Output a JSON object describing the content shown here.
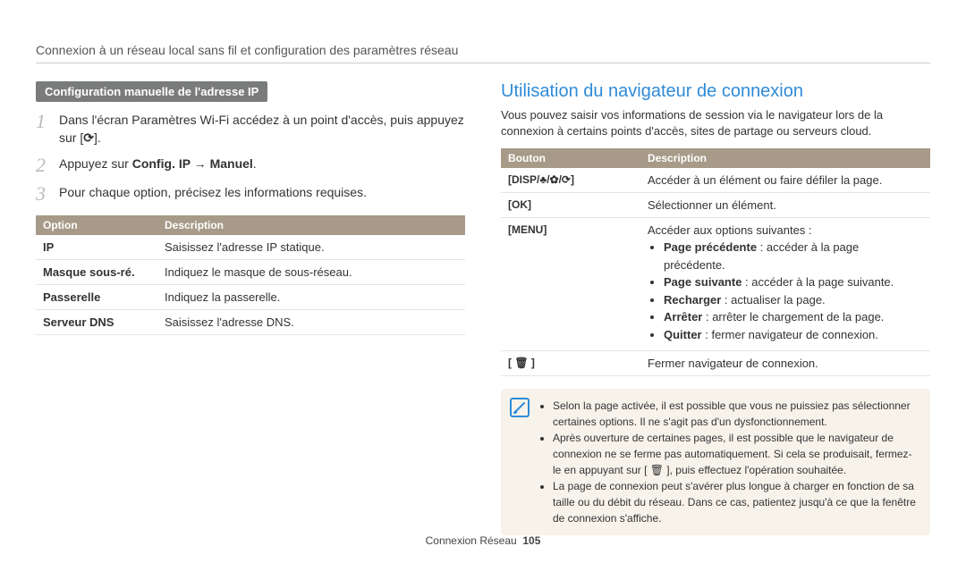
{
  "breadcrumb": "Connexion à un réseau local sans fil et configuration des paramètres réseau",
  "left": {
    "pill": "Configuration manuelle de l'adresse IP",
    "steps": [
      {
        "n": "1",
        "text_pre": "Dans l'écran Paramètres Wi-Fi accédez à un point d'accès, puis appuyez sur [",
        "text_post": "]."
      },
      {
        "n": "2",
        "text_pre": "Appuyez sur ",
        "bold": "Config. IP → Manuel",
        "text_post": "."
      },
      {
        "n": "3",
        "text_pre": "Pour chaque option, précisez les informations requises."
      }
    ],
    "table": {
      "headers": [
        "Option",
        "Description"
      ],
      "rows": [
        [
          "IP",
          "Saisissez l'adresse IP statique."
        ],
        [
          "Masque sous-ré.",
          "Indiquez le masque de sous-réseau."
        ],
        [
          "Passerelle",
          "Indiquez la passerelle."
        ],
        [
          "Serveur DNS",
          "Saisissez l'adresse DNS."
        ]
      ]
    }
  },
  "right": {
    "title": "Utilisation du navigateur de connexion",
    "intro": "Vous pouvez saisir vos informations de session via le navigateur lors de la connexion à certains points d'accès, sites de partage ou serveurs cloud.",
    "table": {
      "headers": [
        "Bouton",
        "Description"
      ],
      "rows": [
        {
          "btn_glyph": "[DISP/♣/✿/⟳]",
          "desc_text": "Accéder à un élément ou faire défiler la page."
        },
        {
          "btn_glyph": "[OK]",
          "desc_text": "Sélectionner un élément."
        },
        {
          "btn_glyph": "[MENU]",
          "desc_list_intro": "Accéder aux options suivantes :",
          "desc_list": [
            {
              "b": "Page précédente",
              "rest": " : accéder à la page précédente."
            },
            {
              "b": "Page suivante",
              "rest": " : accéder à la page suivante."
            },
            {
              "b": "Recharger",
              "rest": " : actualiser la page."
            },
            {
              "b": "Arrêter",
              "rest": " : arrêter le chargement de la page."
            },
            {
              "b": "Quitter",
              "rest": " : fermer navigateur de connexion."
            }
          ]
        },
        {
          "btn_glyph": "[ 🗑 ]",
          "desc_text": "Fermer navigateur de connexion."
        }
      ]
    },
    "notes": [
      "Selon la page activée, il est possible que vous ne puissiez pas sélectionner certaines options. Il ne s'agit pas d'un dysfonctionnement.",
      "Après ouverture de certaines pages, il est possible que le navigateur de connexion ne se ferme pas automatiquement. Si cela se produisait, fermez-le en appuyant sur [ 🗑 ], puis effectuez l'opération souhaitée.",
      "La page de connexion peut s'avérer plus longue à charger en fonction de sa taille ou du débit du réseau. Dans ce cas, patientez jusqu'à ce que la fenêtre de connexion s'affiche."
    ]
  },
  "footer": {
    "label": "Connexion Réseau",
    "page": "105"
  }
}
